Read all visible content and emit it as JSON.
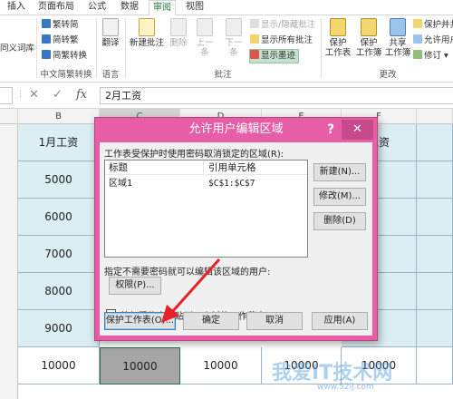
{
  "tabs": [
    "插入",
    "页面布局",
    "公式",
    "数据",
    "审阅",
    "视图"
  ],
  "ribbon": {
    "proofing": {
      "thesaurus": "同义词库"
    },
    "chinese": {
      "to_traditional": "繁转简",
      "to_simplified": "简转繁",
      "conversion": "简繁转换",
      "group": "中文简繁转换"
    },
    "language": {
      "translate": "翻译",
      "group": "语言"
    },
    "comments": {
      "new": "新建批注",
      "delete": "删除",
      "previous": "上一条",
      "next": "下一条",
      "show_hide": "显示/隐藏批注",
      "show_all": "显示所有批注",
      "show_ink": "显示墨迹",
      "group": "批注"
    },
    "changes": {
      "protect_sheet": [
        "保护",
        "工作表"
      ],
      "protect_workbook": [
        "保护",
        "工作簿"
      ],
      "share_workbook": [
        "共享",
        "工作簿"
      ],
      "protect_and_share": "保护并共",
      "allow_edit_ranges": "允许用户",
      "track_changes": "修订",
      "group": "更改"
    }
  },
  "formula_bar": {
    "cancel": "✕",
    "enter": "✓",
    "fx": "fx",
    "value": "2月工资"
  },
  "sheet": {
    "columns": [
      "B",
      "C",
      "D",
      "E",
      "F"
    ],
    "header_b": "1月工资",
    "header_f": "工资",
    "col_b": [
      "5000",
      "6000",
      "7000",
      "8000",
      "9000",
      "10000"
    ],
    "col_c_last": "10000",
    "col_d_last": "10000",
    "col_e_last": "10000",
    "col_f_last": "10000"
  },
  "dialog": {
    "title": "允许用户编辑区域",
    "help": "?",
    "close": "✕",
    "locked_label": "工作表受保护时使用密码取消锁定的区域(R):",
    "col_title": "标题",
    "col_ref": "引用单元格",
    "row_title": "区域1",
    "row_ref": "$C$1:$C$7",
    "new_btn": "新建(N)...",
    "modify_btn": "修改(M)...",
    "delete_btn": "删除(D)",
    "nopwd_label": "指定不需要密码就可以编辑该区域的用户:",
    "perm_btn": "权限(P)...",
    "paste_label": "将权限信息粘贴到一个新的工作薄中(S)",
    "protect_btn": "保护工作表(O)...",
    "ok_btn": "确定",
    "cancel_btn": "取消",
    "apply_btn": "应用(A)"
  },
  "watermark": {
    "text": "我爱IT技术网",
    "url": "www.52ij.com"
  },
  "colors": {
    "accent": "#217346",
    "dialog": "#e75ea6",
    "arrow": "#e8202a"
  }
}
